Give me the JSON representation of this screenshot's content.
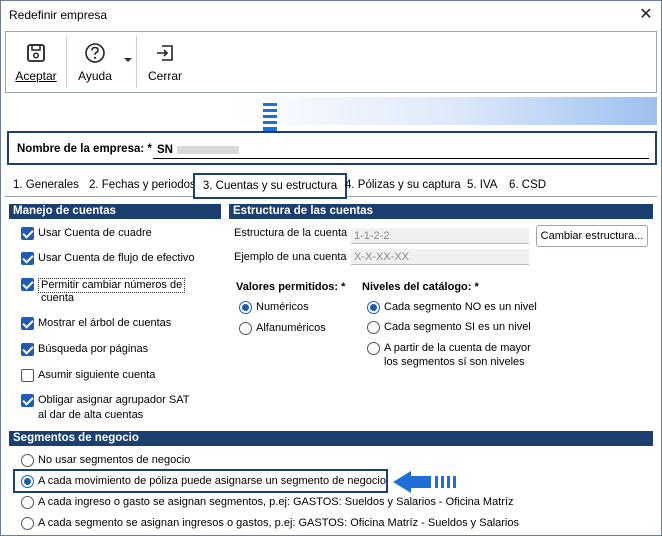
{
  "window": {
    "title": "Redefinir empresa",
    "close": "✕"
  },
  "toolbar": {
    "accept_label": "Aceptar",
    "help_label": "Ayuda",
    "close_label": "Cerrar"
  },
  "company": {
    "label": "Nombre de la empresa: *",
    "value": "SN"
  },
  "tabs": [
    {
      "label": "1. Generales"
    },
    {
      "label": "2. Fechas y periodos"
    },
    {
      "label": "3. Cuentas y su estructura",
      "active": true
    },
    {
      "label": "4. Pólizas y su captura"
    },
    {
      "label": "5. IVA"
    },
    {
      "label": "6. CSD"
    }
  ],
  "manejo": {
    "title": "Manejo de cuentas",
    "options": [
      {
        "label": "Usar Cuenta de cuadre",
        "checked": true
      },
      {
        "label": "Usar Cuenta de flujo de efectivo",
        "checked": true
      },
      {
        "label": "Permitir cambiar números de",
        "label2": "cuenta",
        "checked": true
      },
      {
        "label": "Mostrar el árbol de cuentas",
        "checked": true
      },
      {
        "label": "Búsqueda por páginas",
        "checked": true
      },
      {
        "label": "Asumir siguiente cuenta",
        "checked": false
      },
      {
        "label": "Obligar asignar agrupador SAT",
        "label2": "al dar de alta cuentas",
        "checked": true
      }
    ]
  },
  "estructura": {
    "title": "Estructura de las cuentas",
    "estructura_label": "Estructura de la cuenta",
    "estructura_value": "1-1-2-2",
    "ejemplo_label": "Ejemplo de una cuenta",
    "ejemplo_value": "X-X-XX-XX",
    "change_button": "Cambiar estructura...",
    "valores_title": "Valores permitidos: *",
    "valores": [
      {
        "label": "Numéricos",
        "selected": true
      },
      {
        "label": "Alfanuméricos",
        "selected": false
      }
    ],
    "niveles_title": "Niveles del catálogo: *",
    "niveles": [
      {
        "label": "Cada segmento NO es un nivel",
        "selected": true
      },
      {
        "label": "Cada segmento SI es un nivel",
        "selected": false
      },
      {
        "label": "A partir de la cuenta de mayor",
        "label2": "los segmentos sí son niveles",
        "selected": false
      }
    ]
  },
  "segmentos": {
    "title": "Segmentos de negocio",
    "options": [
      {
        "label": "No usar segmentos de negocio",
        "selected": false
      },
      {
        "label": "A cada movimiento de póliza puede asignarse un segmento de negocio",
        "selected": true
      },
      {
        "label": "A cada ingreso o gasto se asignan segmentos, p.ej: GASTOS: Sueldos y Salarios - Oficina Matríz",
        "selected": false
      },
      {
        "label": "A cada segmento se asignan ingresos o gastos, p.ej: GASTOS: Oficina Matríz - Sueldos y Salarios",
        "selected": false
      }
    ]
  },
  "colors": {
    "header_bg": "#1b3f6e",
    "accent": "#1f5bb5",
    "arrow": "#1f6fd6"
  }
}
